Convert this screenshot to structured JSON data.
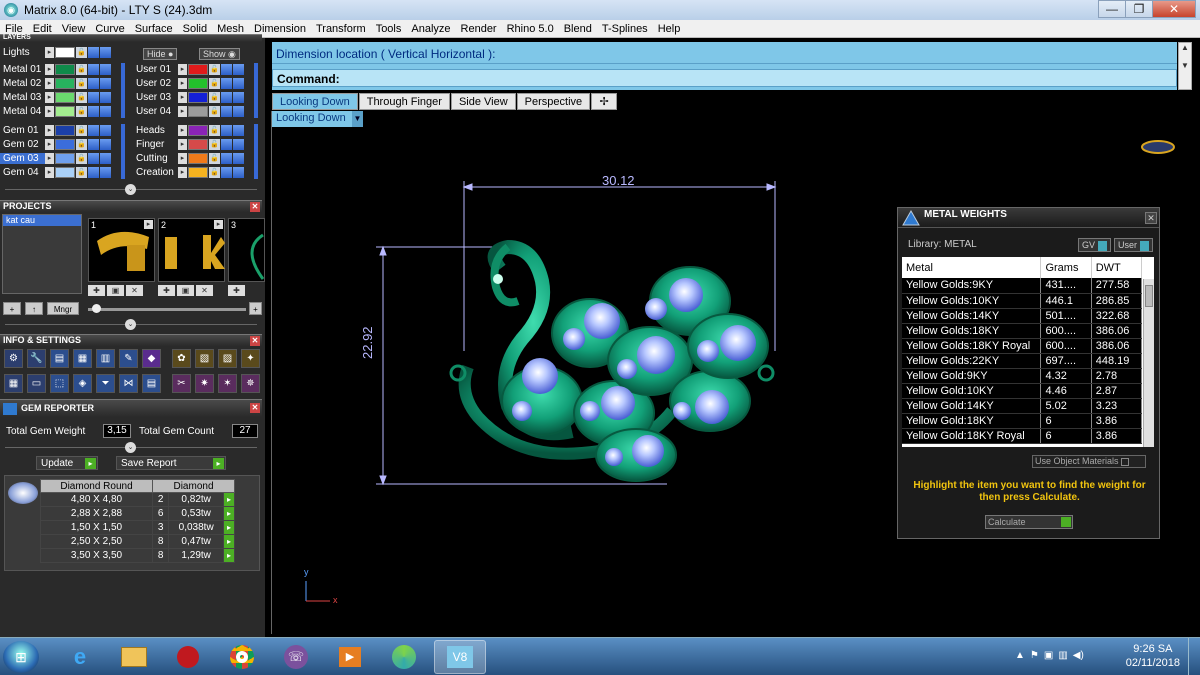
{
  "window": {
    "title": "Matrix 8.0 (64-bit) - LTY  S (24).3dm",
    "btn_min": "—",
    "btn_max": "❐",
    "btn_close": "✕"
  },
  "menu": [
    "File",
    "Edit",
    "View",
    "Curve",
    "Surface",
    "Solid",
    "Mesh",
    "Dimension",
    "Transform",
    "Tools",
    "Analyze",
    "Render",
    "Rhino 5.0",
    "Blend",
    "T-Splines",
    "Help"
  ],
  "layers": {
    "header": "LAYERS",
    "hide_label": "Hide",
    "show_label": "Show",
    "left": [
      {
        "name": "Lights",
        "color": "#ffffff"
      },
      {
        "name": "Metal 01",
        "color": "#0f8a4a"
      },
      {
        "name": "Metal 02",
        "color": "#27b35e"
      },
      {
        "name": "Metal 03",
        "color": "#6ad96e"
      },
      {
        "name": "Metal 04",
        "color": "#a3ec8f"
      },
      {
        "name": "Gem 01",
        "color": "#1b3fa8"
      },
      {
        "name": "Gem 02",
        "color": "#3b6ddc"
      },
      {
        "name": "Gem 03",
        "color": "#6fa0ee"
      },
      {
        "name": "Gem 04",
        "color": "#a9d0f7"
      }
    ],
    "right": [
      {
        "name": "User 01",
        "color": "#e01b1b"
      },
      {
        "name": "User 02",
        "color": "#23c12c"
      },
      {
        "name": "User 03",
        "color": "#1420d6"
      },
      {
        "name": "User 04",
        "color": "#9c9c9c"
      },
      {
        "name": "Heads",
        "color": "#8a24b6"
      },
      {
        "name": "Finger",
        "color": "#d64a4a"
      },
      {
        "name": "Cutting",
        "color": "#f07a1a"
      },
      {
        "name": "Creation",
        "color": "#f5b320"
      }
    ]
  },
  "projects": {
    "header": "PROJECTS",
    "items": [
      "kat cau"
    ],
    "thumbs": [
      "1",
      "2",
      "3"
    ],
    "mgr_label": "Mngr",
    "add": "+",
    "up": "↑"
  },
  "info": {
    "header": "INFO & SETTINGS"
  },
  "gem_reporter": {
    "header": "GEM REPORTER",
    "total_weight_label": "Total Gem Weight",
    "total_weight": "3,15",
    "total_count_label": "Total Gem Count",
    "total_count": "27",
    "update_label": "Update",
    "save_label": "Save Report",
    "col_shape": "Diamond Round",
    "col_material": "Diamond",
    "rows": [
      {
        "size": "4,80 X 4,80",
        "count": "2",
        "weight": "0,82tw"
      },
      {
        "size": "2,88 X 2,88",
        "count": "6",
        "weight": "0,53tw"
      },
      {
        "size": "1,50 X 1,50",
        "count": "3",
        "weight": "0,038tw"
      },
      {
        "size": "2,50 X 2,50",
        "count": "8",
        "weight": "0,47tw"
      },
      {
        "size": "3,50 X 3,50",
        "count": "8",
        "weight": "1,29tw"
      }
    ]
  },
  "command": {
    "prompt": "Dimension location ( Vertical  Horizontal ):",
    "label": "Command:"
  },
  "tabs": [
    {
      "label": "Looking Down",
      "active": true
    },
    {
      "label": "Through Finger",
      "active": false
    },
    {
      "label": "Side View",
      "active": false
    },
    {
      "label": "Perspective",
      "active": false
    },
    {
      "label": "✢",
      "active": false
    }
  ],
  "viewport": {
    "view_label": "Looking Down",
    "dim_width": "30.12",
    "dim_height": "22.92",
    "axis_y": "y",
    "axis_x": "x"
  },
  "metal_weights": {
    "title": "METAL WEIGHTS",
    "library_label": "Library: METAL",
    "gv_label": "GV",
    "user_label": "User",
    "col_metal": "Metal",
    "col_grams": "Grams",
    "col_dwt": "DWT",
    "rows": [
      {
        "metal": "Yellow Golds:9KY",
        "grams": "431....",
        "dwt": "277.58"
      },
      {
        "metal": "Yellow Golds:10KY",
        "grams": "446.1",
        "dwt": "286.85"
      },
      {
        "metal": "Yellow Golds:14KY",
        "grams": "501....",
        "dwt": "322.68"
      },
      {
        "metal": "Yellow Golds:18KY",
        "grams": "600....",
        "dwt": "386.06"
      },
      {
        "metal": "Yellow Golds:18KY Royal",
        "grams": "600....",
        "dwt": "386.06"
      },
      {
        "metal": "Yellow Golds:22KY",
        "grams": "697....",
        "dwt": "448.19"
      },
      {
        "metal": "Yellow Gold:9KY",
        "grams": "4.32",
        "dwt": "2.78"
      },
      {
        "metal": "Yellow Gold:10KY",
        "grams": "4.46",
        "dwt": "2.87"
      },
      {
        "metal": "Yellow Gold:14KY",
        "grams": "5.02",
        "dwt": "3.23"
      },
      {
        "metal": "Yellow Gold:18KY",
        "grams": "6",
        "dwt": "3.86"
      },
      {
        "metal": "Yellow Gold:18KY Royal",
        "grams": "6",
        "dwt": "3.86"
      }
    ],
    "use_object_label": "Use Object Materials",
    "message": "Highlight the item you want to find the weight for then press Calculate.",
    "calculate_label": "Calculate"
  },
  "taskbar": {
    "time": "9:26 SA",
    "date": "02/11/2018"
  }
}
